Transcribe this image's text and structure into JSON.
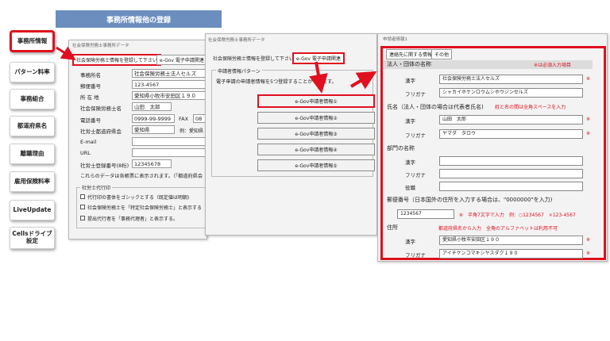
{
  "nav": [
    "事務所情報",
    "パターン料率",
    "事務組合",
    "都道府県名",
    "離職理由",
    "雇用保険料率",
    "LiveUpdate",
    "Cellsドライブ\n設定"
  ],
  "banner": "事務所情報他の登録",
  "panel1": {
    "title": "社会保険労務士事務所データ",
    "tab_active": "社会保険労務士情報を登録して下さい",
    "tab_other": "e-Gov 電子申請関連",
    "rows": [
      {
        "label": "事務所名",
        "value": "社会保険労務士法人セルズ"
      },
      {
        "label": "郵便番号",
        "value": "123-4567"
      },
      {
        "label": "所 在 地",
        "value": "愛知県小牧市安田区１９０"
      },
      {
        "label": "社会保険労務士名",
        "value": "山田　太郎"
      },
      {
        "label": "電話番号",
        "value": "0999-99-9999"
      },
      {
        "label": "社労士都道府県会",
        "value": "愛知県"
      },
      {
        "label": "E-mail",
        "value": ""
      },
      {
        "label": "URL",
        "value": ""
      },
      {
        "label": "社労士登録番号(8桁)",
        "value": "12345678"
      }
    ],
    "fax_label": "FAX",
    "fax_value": "08",
    "pref_hint": "例：愛知県",
    "note": "これらのデータは各帳票に表示されます。（「都道府県会",
    "group_title": "社労士代行印",
    "checks": [
      "代行印の書体をゴシックとする（既定値は明朝)",
      "社会保険労務士を「特定社会保険労務士」と表示する",
      "提出代行者を「事務代理者」と表示する。"
    ]
  },
  "panel2": {
    "title": "社会保険労務士事務所データ",
    "tab_inactive": "社会保険労務士情報を登録して下さい",
    "tab_active": "e-Gov 電子申請関連",
    "group_title": "申請者情報パターン",
    "desc": "電子申請の申請者情報を5つ登録することができます。",
    "buttons": [
      "e-Gov申請者情報①",
      "e-Gov申請者情報②",
      "e-Gov申請者情報③",
      "e-Gov申請者情報④",
      "e-Gov申請者情報⑤"
    ]
  },
  "panel3": {
    "title": "申請者情報1",
    "tabs": [
      "連絡先に関する情報",
      "その他"
    ],
    "header1": "法人・団体の名称",
    "required_note": "※は必須入力項目",
    "kanji_label": "漢字",
    "furigana_label": "フリガナ",
    "yakushoku_label": "役職",
    "corp_kanji": "社会保険労務士法人セルズ",
    "corp_furi": "シャカイホケンロウムシホウジンセルズ",
    "sec_name": "氏名（法人・団体の場合は代表者氏名)",
    "name_note": "姓と名の間は全角スペースを入力",
    "name_kanji": "山田　太郎",
    "name_furi": "ヤマダ　タロウ",
    "sec_dept": "部門の名称",
    "sec_zip": "郵便番号（日本国外の住所を入力する場合は、\"0000000\"を入力)",
    "zip_value": "1234567",
    "zip_note": "※　半角7文字で入力　例：○1234567　×123-4567",
    "sec_addr": "住所",
    "addr_note": "都道府県名から入力　全角のアルファベットは利用不可",
    "addr_kanji": "愛知県小牧市安田区１９０",
    "addr_furi": "アイチケンコマキシヤスダク１９０",
    "star": "※"
  },
  "colors": {
    "highlight": "#e0101e",
    "banner": "#6c8ebf"
  }
}
